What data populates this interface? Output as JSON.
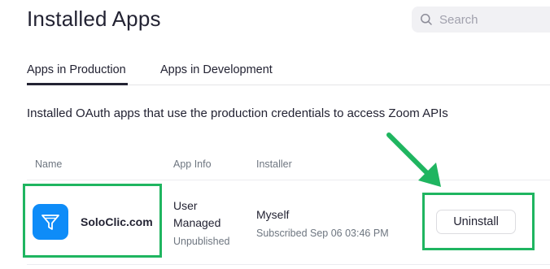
{
  "header": {
    "title": "Installed Apps",
    "search_placeholder": "Search"
  },
  "tabs": [
    {
      "label": "Apps in Production",
      "active": true
    },
    {
      "label": "Apps in Development",
      "active": false
    }
  ],
  "description": "Installed OAuth apps that use the production credentials to access Zoom APIs",
  "table": {
    "columns": [
      "Name",
      "App Info",
      "Installer"
    ],
    "rows": [
      {
        "name": "SoloClic.com",
        "icon": "funnel-icon",
        "app_info": "User Managed",
        "app_status": "Unpublished",
        "installer": "Myself",
        "installed_on": "Subscribed Sep 06 03:46 PM",
        "action_label": "Uninstall"
      }
    ]
  },
  "colors": {
    "accent": "#0e8cf8",
    "highlight": "#1fb560",
    "text": "#232333",
    "muted": "#6e7680"
  }
}
